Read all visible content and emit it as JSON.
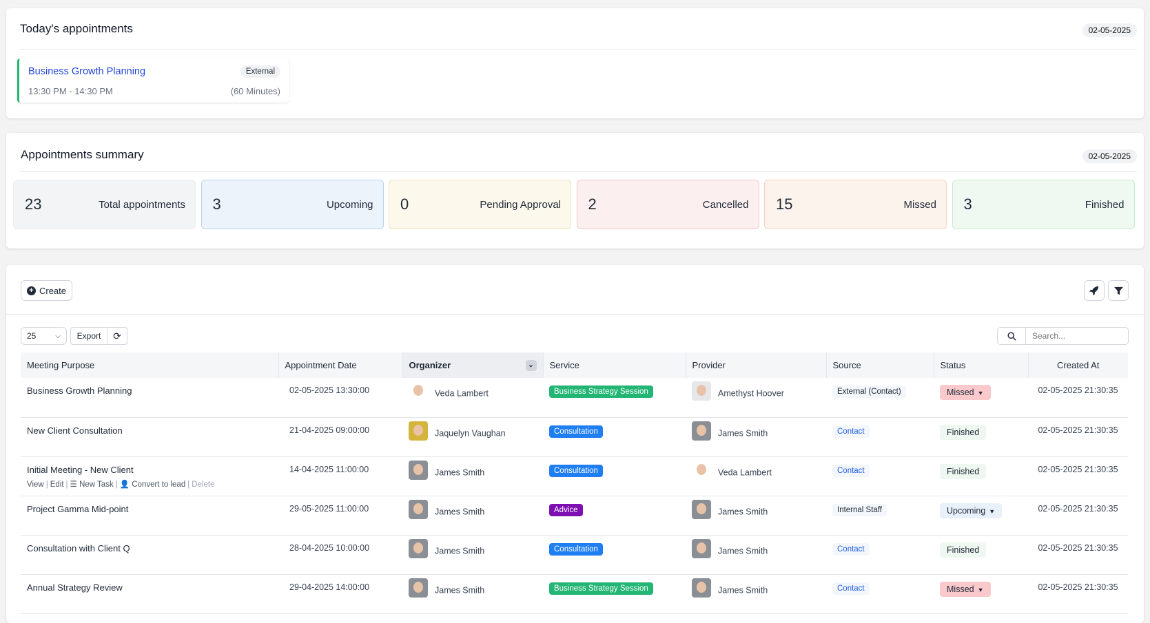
{
  "today": {
    "title": "Today's appointments",
    "date": "02-05-2025",
    "appointment": {
      "name": "Business Growth Planning",
      "badge": "External",
      "time": "13:30 PM - 14:30 PM",
      "duration": "(60 Minutes)"
    }
  },
  "summary": {
    "title": "Appointments summary",
    "date": "02-05-2025",
    "stats": [
      {
        "value": "23",
        "label": "Total appointments",
        "bg": "#f3f4f6",
        "border": "#eceef1"
      },
      {
        "value": "3",
        "label": "Upcoming",
        "bg": "#ecf3fb",
        "border": "#b9d3ea"
      },
      {
        "value": "0",
        "label": "Pending Approval",
        "bg": "#fdf8ec",
        "border": "#f2e3c0"
      },
      {
        "value": "2",
        "label": "Cancelled",
        "bg": "#fcefef",
        "border": "#f2c6c9"
      },
      {
        "value": "15",
        "label": "Missed",
        "bg": "#fdf3ed",
        "border": "#f5d2c0"
      },
      {
        "value": "3",
        "label": "Finished",
        "bg": "#eff9f1",
        "border": "#c7ebd0"
      }
    ]
  },
  "toolbar": {
    "create": "Create",
    "page_size": "25",
    "export": "Export",
    "search_placeholder": "Search..."
  },
  "table": {
    "headers": [
      "Meeting Purpose",
      "Appointment Date",
      "Organizer",
      "Service",
      "Provider",
      "Source",
      "Status",
      "Created At"
    ],
    "actions": {
      "view": "View",
      "edit": "Edit",
      "new_task": "New Task",
      "convert": "Convert to lead",
      "delete": "Delete"
    },
    "rows": [
      {
        "purpose": "Business Growth Planning",
        "date": "02-05-2025 13:30:00",
        "organizer": "Veda Lambert",
        "service": "Business Strategy Session",
        "service_color": "#22b573",
        "provider": "Amethyst Hoover",
        "source": "External (Contact)",
        "status": "Missed",
        "created": "02-05-2025 21:30:35"
      },
      {
        "purpose": "New Client Consultation",
        "date": "21-04-2025 09:00:00",
        "organizer": "Jaquelyn Vaughan",
        "service": "Consultation",
        "service_color": "#1e7ef2",
        "provider": "James Smith",
        "source": "Contact",
        "status": "Finished",
        "created": "02-05-2025 21:30:35"
      },
      {
        "purpose": "Initial Meeting - New Client",
        "date": "14-04-2025 11:00:00",
        "organizer": "James Smith",
        "service": "Consultation",
        "service_color": "#1e7ef2",
        "provider": "Veda Lambert",
        "source": "Contact",
        "status": "Finished",
        "created": "02-05-2025 21:30:35"
      },
      {
        "purpose": "Project Gamma Mid-point",
        "date": "29-05-2025 11:00:00",
        "organizer": "James Smith",
        "service": "Advice",
        "service_color": "#7e0fb3",
        "provider": "James Smith",
        "source": "Internal Staff",
        "status": "Upcoming",
        "created": "02-05-2025 21:30:35"
      },
      {
        "purpose": "Consultation with Client Q",
        "date": "28-04-2025 10:00:00",
        "organizer": "James Smith",
        "service": "Consultation",
        "service_color": "#1e7ef2",
        "provider": "James Smith",
        "source": "Contact",
        "status": "Finished",
        "created": "02-05-2025 21:30:35"
      },
      {
        "purpose": "Annual Strategy Review",
        "date": "29-04-2025 14:00:00",
        "organizer": "James Smith",
        "service": "Business Strategy Session",
        "service_color": "#22b573",
        "provider": "James Smith",
        "source": "Contact",
        "status": "Missed",
        "created": "02-05-2025 21:30:35"
      }
    ]
  }
}
